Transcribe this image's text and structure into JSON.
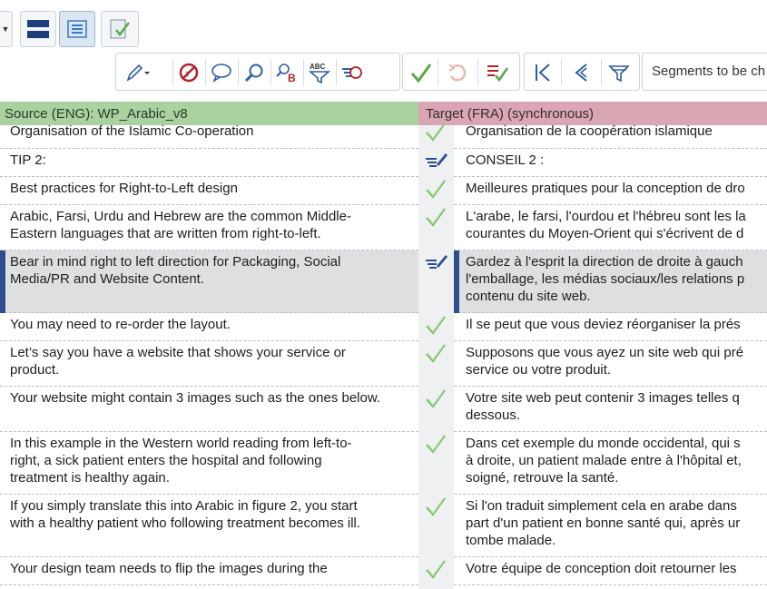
{
  "toolbar_top": {
    "icons": [
      "dropdown-arrow-icon",
      "split-horizontal-icon",
      "list-view-icon",
      "checklist-icon"
    ]
  },
  "toolbar_edit": {
    "icons": [
      "pen-icon",
      "no-comment-icon",
      "comment-icon",
      "search-icon",
      "replace-icon",
      "spell-check-filter-icon",
      "run-qa-icon",
      "confirm-icon",
      "undo-icon",
      "confirm-list-icon",
      "first-segment-icon",
      "previous-segment-icon",
      "filter-icon"
    ],
    "filter_value": "Segments to be ch"
  },
  "header": {
    "source": "Source (ENG): WP_Arabic_v8",
    "target": "Target (FRA) (synchronous)"
  },
  "colors": {
    "source_header": "#a9d2a0",
    "target_header": "#d9a7b3",
    "confirmed_check": "#64b64a",
    "edited_icon": "#2e4f8f",
    "active_marker": "#2e4f8f"
  },
  "segments": [
    {
      "status": "confirmed",
      "source": [
        "Organisation of the Islamic Co-operation"
      ],
      "target": [
        "Organisation de la coopération islamique"
      ]
    },
    {
      "status": "edited",
      "source": [
        "TIP 2:"
      ],
      "target": [
        "CONSEIL 2 :"
      ]
    },
    {
      "status": "confirmed",
      "source": [
        "Best practices for Right-to-Left design"
      ],
      "target": [
        "Meilleures pratiques pour la conception de dro"
      ]
    },
    {
      "status": "confirmed",
      "source": [
        "Arabic, Farsi, Urdu and Hebrew are the common Middle-",
        "Eastern languages that are written from right-to-left."
      ],
      "target": [
        "L'arabe, le farsi, l'ourdou et l'hébreu sont les la",
        "courantes du Moyen-Orient qui s'écrivent de d"
      ]
    },
    {
      "status": "edited",
      "active": true,
      "source": [
        "Bear in mind right to left direction for Packaging, Social",
        "Media/PR and Website Content."
      ],
      "target": [
        "Gardez à l'esprit la direction de droite à gauch",
        "l'emballage, les médias sociaux/les relations p",
        "contenu du site web."
      ]
    },
    {
      "status": "confirmed",
      "source": [
        "You may need to re-order the layout."
      ],
      "target": [
        "Il se peut que vous deviez réorganiser la prés"
      ]
    },
    {
      "status": "confirmed",
      "source": [
        "Let’s say you have a website that shows your service or",
        "product."
      ],
      "target": [
        "Supposons que vous ayez un site web qui pré",
        "service ou votre produit."
      ]
    },
    {
      "status": "confirmed",
      "source": [
        "Your website might contain 3 images such as the ones below."
      ],
      "target": [
        "Votre site web peut contenir 3 images telles q",
        "dessous."
      ]
    },
    {
      "status": "confirmed",
      "source": [
        "In this example in the Western world reading from left-to-",
        "right, a sick patient enters the hospital and following",
        "treatment is healthy again."
      ],
      "target": [
        "Dans cet exemple du monde occidental, qui s",
        "à droite, un patient malade entre à l'hôpital et,",
        "soigné, retrouve la santé."
      ]
    },
    {
      "status": "confirmed",
      "source": [
        "If you simply translate this into Arabic in figure 2, you start",
        "with a healthy patient who following treatment becomes ill."
      ],
      "target": [
        "Si l'on traduit simplement cela en arabe dans",
        "part d'un patient en bonne santé qui, après ur",
        "tombe malade."
      ]
    },
    {
      "status": "confirmed",
      "source": [
        "Your design team needs to flip the images during the"
      ],
      "target": [
        "Votre équipe de conception doit retourner les"
      ]
    }
  ]
}
